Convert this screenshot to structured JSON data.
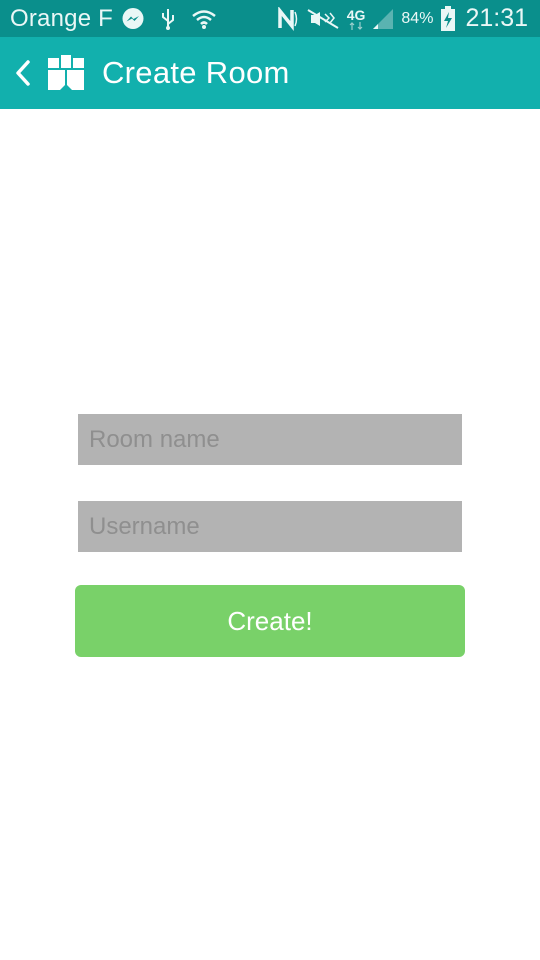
{
  "status_bar": {
    "carrier": "Orange F",
    "network_type": "4G",
    "battery_percent": "84%",
    "time": "21:31",
    "icons": [
      "messenger-icon",
      "usb-icon",
      "wifi-icon",
      "nfc-icon",
      "mute-icon",
      "signal-icon",
      "battery-charging-icon"
    ]
  },
  "app_bar": {
    "title": "Create Room",
    "back_icon": "chevron-left-icon",
    "logo_icon": "app-logo-icon"
  },
  "form": {
    "room_name": {
      "value": "",
      "placeholder": "Room name"
    },
    "username": {
      "value": "",
      "placeholder": "Username"
    },
    "create_label": "Create!"
  },
  "colors": {
    "status_bar": "#0a8f8c",
    "app_bar": "#12b0ad",
    "field_bg": "#b3b3b3",
    "button_bg": "#79d169"
  }
}
